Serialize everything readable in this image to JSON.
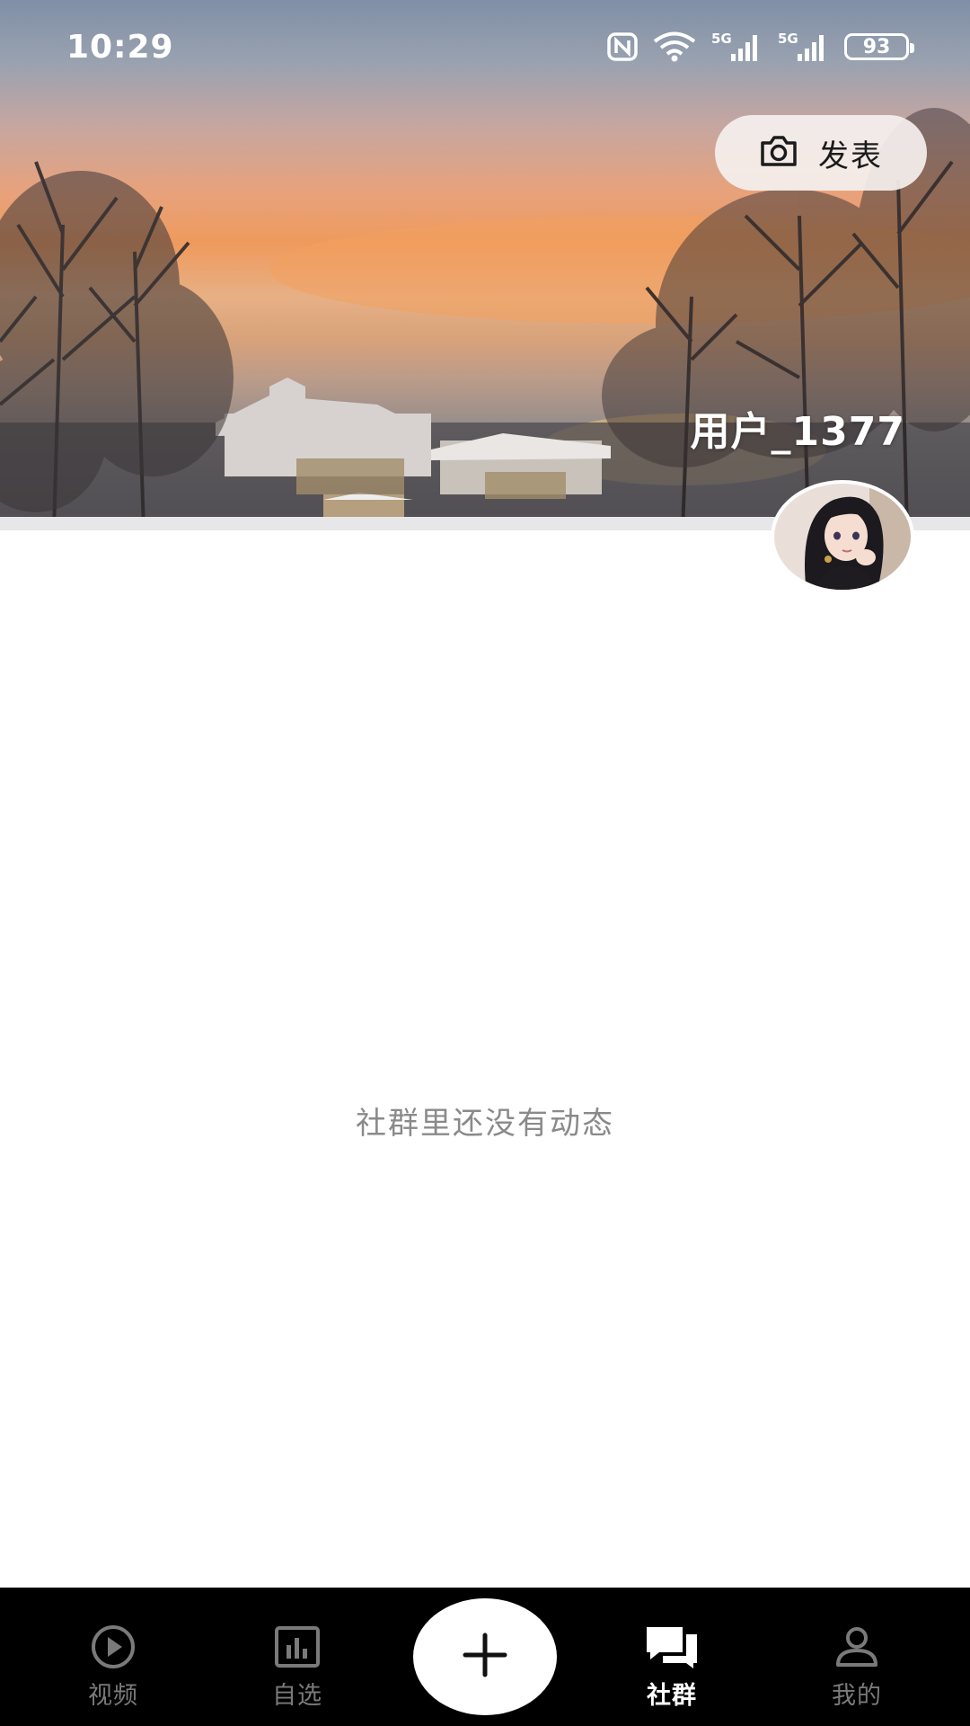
{
  "status_bar": {
    "time": "10:29",
    "signal_1": "5G",
    "signal_2": "5G",
    "battery": "93"
  },
  "header": {
    "publish_label": "发表",
    "user_name": "用户_1377"
  },
  "main": {
    "empty_message": "社群里还没有动态"
  },
  "bottom_nav": {
    "items": [
      {
        "label": "视频",
        "icon": "play-circle-icon"
      },
      {
        "label": "自选",
        "icon": "bar-chart-icon"
      },
      {
        "label": "",
        "icon": "plus-icon"
      },
      {
        "label": "社群",
        "icon": "chat-bubbles-icon"
      },
      {
        "label": "我的",
        "icon": "person-icon"
      }
    ],
    "active_index": 3
  },
  "colors": {
    "nav_background": "#000000",
    "active_text": "#ffffff",
    "inactive_text": "#7a7a7a",
    "empty_text": "#8a8a8a"
  }
}
